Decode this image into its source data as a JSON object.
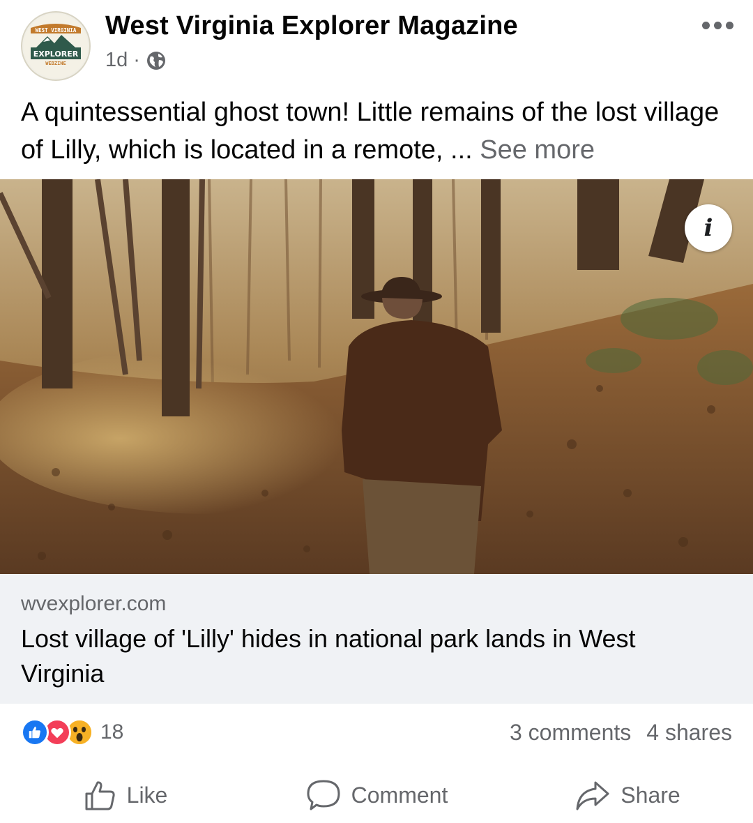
{
  "post": {
    "page_name": "West Virginia Explorer Magazine",
    "time_ago": "1d",
    "separator": "·",
    "audience_icon": "globe-icon",
    "more_icon": "more-horizontal-icon",
    "text": "A quintessential ghost town! Little remains of the lost village of Lilly, which is located in a remote, ...",
    "see_more": "See more"
  },
  "avatar": {
    "top_text": "WEST VIRGINIA",
    "main_text": "EXPLORER",
    "bottom_text": "WEBZINE"
  },
  "photo": {
    "info_icon": "info-icon",
    "info_label": "i"
  },
  "link": {
    "domain": "wvexplorer.com",
    "title": "Lost village of 'Lilly' hides in national park lands in West Virginia"
  },
  "stats": {
    "reaction_icons": [
      "like-reaction-icon",
      "love-reaction-icon",
      "wow-reaction-icon"
    ],
    "reaction_count": "18",
    "comments": "3 comments",
    "shares": "4 shares"
  },
  "actions": {
    "like": "Like",
    "comment": "Comment",
    "share": "Share"
  },
  "colors": {
    "secondary_text": "#65676b",
    "link_box_bg": "#f0f2f5",
    "like_blue": "#1877f2",
    "love_red": "#f33e58",
    "wow_yellow": "#f7b125"
  }
}
